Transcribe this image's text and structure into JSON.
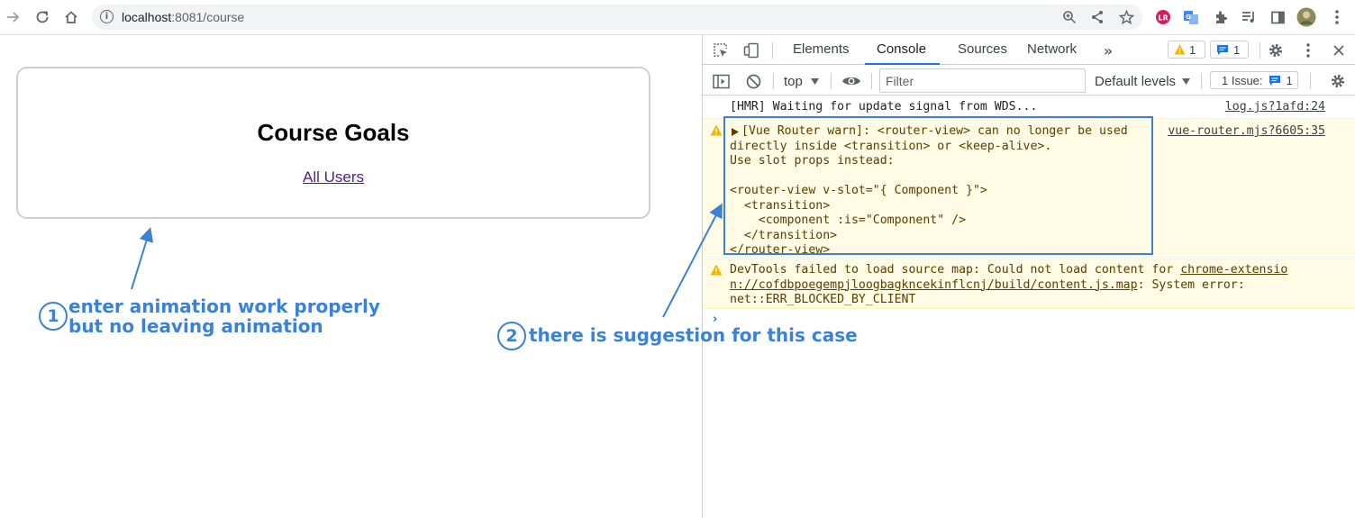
{
  "browser": {
    "url_host": "localhost",
    "url_rest": ":8081/course"
  },
  "page": {
    "title": "Course Goals",
    "link": "All Users"
  },
  "devtools": {
    "tabs": [
      {
        "label": "Elements",
        "active": false
      },
      {
        "label": "Console",
        "active": true
      },
      {
        "label": "Sources",
        "active": false
      },
      {
        "label": "Network",
        "active": false
      }
    ],
    "warning_count": "1",
    "info_count": "1",
    "context": "top",
    "filter_placeholder": "Filter",
    "levels_label": "Default levels",
    "issues_label": "1 Issue:",
    "issues_count": "1",
    "messages": {
      "hmr": {
        "text": "[HMR] Waiting for update signal from WDS...",
        "source": "log.js?1afd:24"
      },
      "router_warn": {
        "lines": [
          "[Vue Router warn]: <router-view> can no longer be used",
          "directly inside <transition> or <keep-alive>.",
          "Use slot props instead:",
          "",
          "<router-view v-slot=\"{ Component }\">",
          "  <transition>",
          "    <component :is=\"Component\" />",
          "  </transition>",
          "</router-view>"
        ],
        "source": "vue-router.mjs?6605:35"
      },
      "sourcemap": {
        "line1_prefix": "DevTools failed to load source map: Could not load content for ",
        "line1_link": "chrome-extensio",
        "line2_link": "n://cofdbpoegempjloogbagkncekinflcnj/build/content.js.map",
        "line2_suffix": ": System error:",
        "line3": "net::ERR_BLOCKED_BY_CLIENT"
      },
      "prompt": "›"
    }
  },
  "annotations": {
    "one": {
      "number": "1",
      "line1": "enter animation work properly",
      "line2": "but no leaving animation"
    },
    "two": {
      "number": "2",
      "text": "there is suggestion for this case"
    },
    "color": "#3b82d6"
  }
}
